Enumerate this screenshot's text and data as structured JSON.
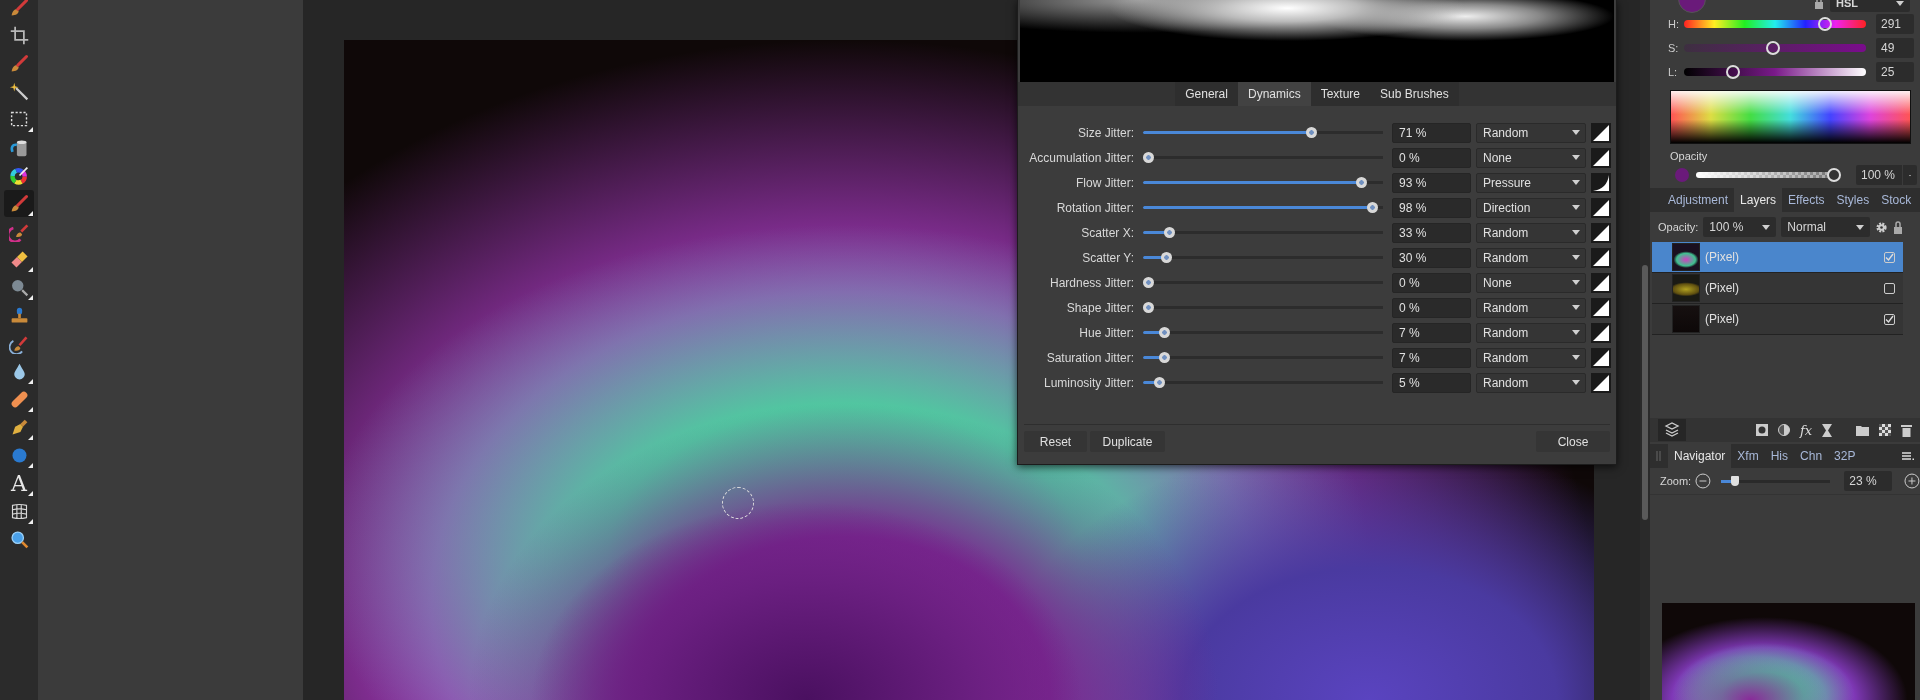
{
  "tools": [
    {
      "kind": "brush",
      "selected": false,
      "has_submenu": false
    },
    {
      "kind": "crop",
      "selected": false,
      "has_submenu": false
    },
    {
      "kind": "brush",
      "selected": false,
      "has_submenu": false
    },
    {
      "kind": "wand",
      "selected": false,
      "has_submenu": false
    },
    {
      "kind": "marquee",
      "selected": false,
      "has_submenu": true
    },
    {
      "kind": "bucket",
      "selected": false,
      "has_submenu": false
    },
    {
      "kind": "wheel",
      "selected": false,
      "has_submenu": false
    },
    {
      "kind": "brush",
      "selected": true,
      "has_submenu": true
    },
    {
      "kind": "swirl",
      "selected": false,
      "has_submenu": false
    },
    {
      "kind": "eraser",
      "selected": false,
      "has_submenu": true
    },
    {
      "kind": "lens",
      "selected": false,
      "has_submenu": true
    },
    {
      "kind": "stamp",
      "selected": false,
      "has_submenu": false
    },
    {
      "kind": "undo",
      "selected": false,
      "has_submenu": false
    },
    {
      "kind": "drop",
      "selected": false,
      "has_submenu": true
    },
    {
      "kind": "bandage",
      "selected": false,
      "has_submenu": true
    },
    {
      "kind": "pen",
      "selected": false,
      "has_submenu": true
    },
    {
      "kind": "ellipse",
      "selected": false,
      "has_submenu": true
    },
    {
      "kind": "text",
      "glyph": "A",
      "selected": false,
      "has_submenu": true
    },
    {
      "kind": "mesh",
      "selected": false,
      "has_submenu": true
    },
    {
      "kind": "zoom",
      "selected": false,
      "has_submenu": false
    }
  ],
  "brush_dialog": {
    "tabs": [
      {
        "label": "General",
        "selected": false
      },
      {
        "label": "Dynamics",
        "selected": true
      },
      {
        "label": "Texture",
        "selected": false
      },
      {
        "label": "Sub Brushes",
        "selected": false
      }
    ],
    "rows": [
      {
        "label": "Size Jitter:",
        "level": 0.71,
        "value": "71 %",
        "controller": "Random",
        "kind": "linear"
      },
      {
        "label": "Accumulation Jitter:",
        "level": 0,
        "value": "0 %",
        "controller": "None",
        "kind": "linear"
      },
      {
        "label": "Flow Jitter:",
        "level": 0.93,
        "value": "93 %",
        "controller": "Pressure",
        "kind": "concave"
      },
      {
        "label": "Rotation Jitter:",
        "level": 0.98,
        "value": "98 %",
        "controller": "Direction",
        "kind": "linear"
      },
      {
        "label": "Scatter X:",
        "level": 0.09,
        "value": "33 %",
        "controller": "Random",
        "kind": "linear"
      },
      {
        "label": "Scatter Y:",
        "level": 0.08,
        "value": "30 %",
        "controller": "Random",
        "kind": "linear"
      },
      {
        "label": "Hardness Jitter:",
        "level": 0,
        "value": "0 %",
        "controller": "None",
        "kind": "linear"
      },
      {
        "label": "Shape Jitter:",
        "level": 0,
        "value": "0 %",
        "controller": "Random",
        "kind": "linear"
      },
      {
        "label": "Hue Jitter:",
        "level": 0.07,
        "value": "7 %",
        "controller": "Random",
        "kind": "linear"
      },
      {
        "label": "Saturation Jitter:",
        "level": 0.07,
        "value": "7 %",
        "controller": "Random",
        "kind": "linear"
      },
      {
        "label": "Luminosity Jitter:",
        "level": 0.05,
        "value": "5 %",
        "controller": "Random",
        "kind": "linear"
      }
    ],
    "left_buttons": [
      "Reset",
      "Duplicate"
    ],
    "close_button": "Close"
  },
  "color_panel": {
    "model": "HSL",
    "channels": [
      {
        "label": "H:",
        "kind": "hue",
        "level": 0.8,
        "value": "291"
      },
      {
        "label": "S:",
        "kind": "saturation",
        "level": 0.49,
        "value": "49"
      },
      {
        "label": "L:",
        "kind": "lightness",
        "level": 0.25,
        "value": "25"
      }
    ],
    "opacity": {
      "label": "Opacity",
      "level": 1,
      "value": "100 %"
    }
  },
  "layers_panel": {
    "tabs": [
      {
        "label": "Adjustment",
        "selected": false
      },
      {
        "label": "Layers",
        "selected": true
      },
      {
        "label": "Effects",
        "selected": false
      },
      {
        "label": "Styles",
        "selected": false
      },
      {
        "label": "Stock",
        "selected": false
      }
    ],
    "opacity_label": "Opacity:",
    "opacity_value": "100 %",
    "blend_mode": "Normal",
    "layers": [
      {
        "name": "(Pixel)",
        "kind": "fur",
        "selected": true,
        "visible": true
      },
      {
        "name": "(Pixel)",
        "kind": "grass",
        "selected": false,
        "visible": false
      },
      {
        "name": "(Pixel)",
        "kind": "dark",
        "selected": false,
        "visible": true
      }
    ],
    "fx_label": "fx"
  },
  "navigator_panel": {
    "tabs": [
      {
        "label": "Navigator",
        "selected": true
      },
      {
        "label": "Xfm",
        "selected": false
      },
      {
        "label": "His",
        "selected": false
      },
      {
        "label": "Chn",
        "selected": false
      },
      {
        "label": "32P",
        "selected": false
      }
    ],
    "zoom": {
      "label": "Zoom:",
      "level": 0.1,
      "value": "23 %"
    }
  }
}
